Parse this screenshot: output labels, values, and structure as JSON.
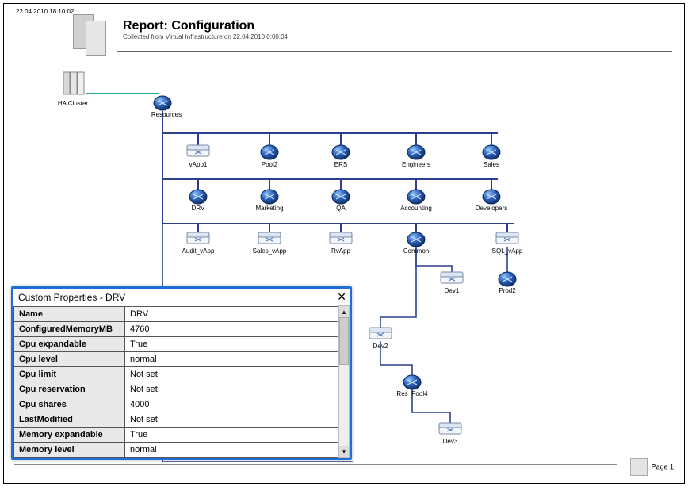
{
  "header": {
    "timestamp": "22.04.2010 18:10:02",
    "title": "Report: Configuration",
    "subtitle": "Collected from Virtual Infrastructure on 22.04.2010 0:00:04"
  },
  "nodes": {
    "cluster": "HA Cluster",
    "resources": "Resources",
    "row1": [
      "vApp1",
      "Pool2",
      "ERS",
      "Engineers",
      "Sales"
    ],
    "row2": [
      "DRV",
      "Marketing",
      "QA",
      "Accounting",
      "Developers"
    ],
    "row3": [
      "Audit_vApp",
      "Sales_vApp",
      "RvApp",
      "Common",
      "SQL_vApp"
    ],
    "dev1": "Dev1",
    "prod2": "Prod2",
    "dev2": "Dev2",
    "res_pool4": "Res_Pool4",
    "dev3": "Dev3"
  },
  "panel": {
    "title": "Custom Properties - DRV",
    "rows": [
      [
        "Name",
        "DRV"
      ],
      [
        "ConfiguredMemoryMB",
        "4760"
      ],
      [
        "Cpu expandable",
        "True"
      ],
      [
        "Cpu level",
        "normal"
      ],
      [
        "Cpu limit",
        "Not set"
      ],
      [
        "Cpu reservation",
        "Not set"
      ],
      [
        "Cpu shares",
        "4000"
      ],
      [
        "LastModified",
        "Not set"
      ],
      [
        "Memory expandable",
        "True"
      ],
      [
        "Memory level",
        "normal"
      ]
    ]
  },
  "footer": {
    "page": "Page 1"
  }
}
